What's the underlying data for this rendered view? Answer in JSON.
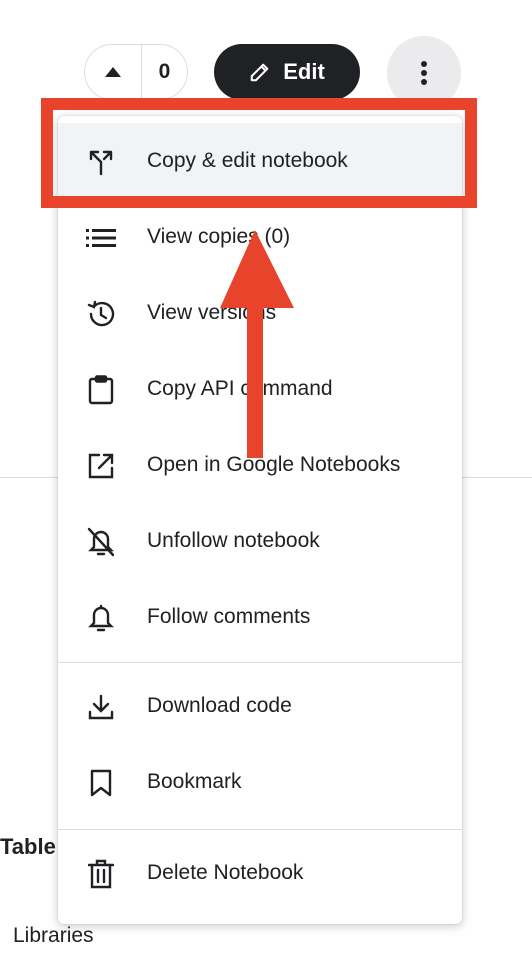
{
  "vote": {
    "count": "0",
    "up_icon": "triangle-up-icon"
  },
  "edit_button": {
    "label": "Edit",
    "icon": "pencil-icon"
  },
  "more_button": {
    "icon": "vertical-dots-icon"
  },
  "menu": {
    "items": [
      {
        "label": "Copy & edit notebook",
        "icon": "fork-icon",
        "highlighted": true
      },
      {
        "label": "View copies (0)",
        "icon": "list-icon"
      },
      {
        "label": "View versions",
        "icon": "history-icon"
      },
      {
        "label": "Copy API command",
        "icon": "clipboard-icon"
      },
      {
        "label": "Open in Google Notebooks",
        "icon": "open-external-icon"
      },
      {
        "label": "Unfollow notebook",
        "icon": "bell-off-icon"
      },
      {
        "label": "Follow comments",
        "icon": "bell-icon"
      },
      {
        "label": "Download code",
        "icon": "download-icon"
      },
      {
        "label": "Bookmark",
        "icon": "bookmark-icon"
      },
      {
        "label": "Delete Notebook",
        "icon": "trash-icon"
      }
    ]
  },
  "background": {
    "table_text": "Table",
    "libraries_text": "Libraries"
  },
  "annotation": {
    "color": "#e8432b"
  }
}
